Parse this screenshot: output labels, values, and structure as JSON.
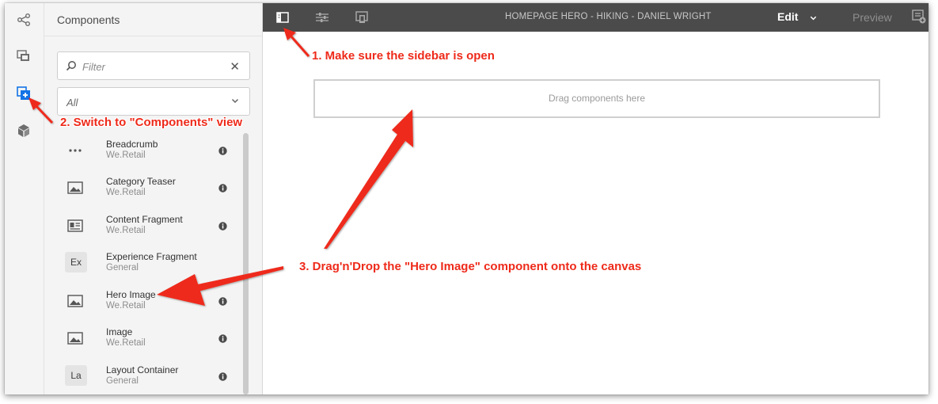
{
  "panel": {
    "title": "Components",
    "filter_placeholder": "Filter",
    "clear_symbol": "✕",
    "group_select_value": "All"
  },
  "rail_icons": [
    "share-icon",
    "assets-icon",
    "components-icon",
    "content-tree-icon"
  ],
  "components": [
    {
      "name": "Breadcrumb",
      "group": "We.Retail",
      "thumb": "dots-icon"
    },
    {
      "name": "Category Teaser",
      "group": "We.Retail",
      "thumb": "image-icon"
    },
    {
      "name": "Content Fragment",
      "group": "We.Retail",
      "thumb": "card-icon"
    },
    {
      "name": "Experience Fragment",
      "group": "General",
      "thumb_text": "Ex"
    },
    {
      "name": "Hero Image",
      "group": "We.Retail",
      "thumb": "image-icon"
    },
    {
      "name": "Image",
      "group": "We.Retail",
      "thumb": "image-icon"
    },
    {
      "name": "Layout Container",
      "group": "General",
      "thumb_text": "La"
    }
  ],
  "topbar": {
    "page_title": "HOMEPAGE HERO - HIKING - DANIEL WRIGHT",
    "mode": "Edit",
    "preview": "Preview"
  },
  "canvas": {
    "dropzone_text": "Drag components here"
  },
  "annotations": {
    "step1": "1. Make sure the sidebar is open",
    "step2": "2. Switch to \"Components\" view",
    "step3": "3. Drag'n'Drop the \"Hero Image\" component onto the canvas"
  },
  "colors": {
    "topbar": "#4b4b4b",
    "panel": "#f4f4f4",
    "active_icon": "#1473e6",
    "annotation": "#ee2a1a"
  }
}
